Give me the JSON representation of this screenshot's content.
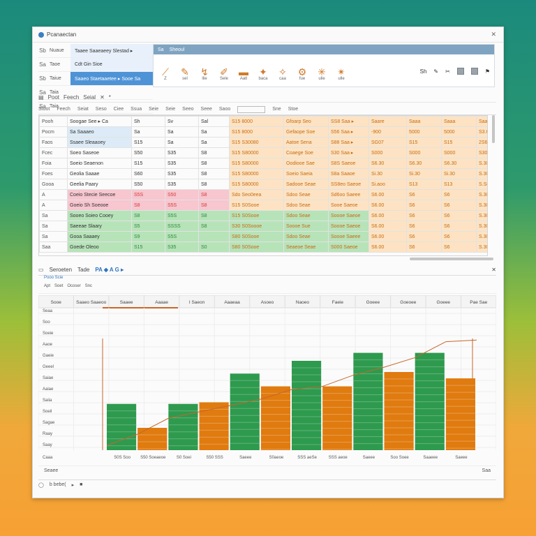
{
  "window": {
    "title": "Pcanaectan"
  },
  "nav": {
    "rows": [
      {
        "icon": "Sb",
        "label": "Nuaue",
        "value": "Taaee Saaeaeey   Slestad ▸"
      },
      {
        "icon": "Sa",
        "label": "Taoe",
        "value": "Cdt Gin  Sioe"
      },
      {
        "icon": "Sb",
        "label": "Taiue",
        "value": "Saaeo Staetaaetee ▸ Sooe Sa"
      },
      {
        "icon": "Sa",
        "label": "Taia",
        "value": ""
      },
      {
        "icon": "Sa",
        "label": "Taia",
        "value": ""
      }
    ]
  },
  "ribbon": {
    "tabs": [
      "Sa",
      "Sheoul"
    ],
    "tools": [
      "Z",
      "sel",
      "llie",
      "Sele",
      "Aatl",
      "baca",
      "caa",
      "fue",
      "ulie",
      "ulle"
    ],
    "right": [
      "Sh"
    ]
  },
  "toolbar2": {
    "items": [
      "Poot",
      "Feech",
      "Seial",
      "✕",
      "*"
    ]
  },
  "toolbar3": {
    "items": [
      "Stoot",
      "Feech",
      "Seiat",
      "Seso",
      "Ciee",
      "Ssua",
      "Seie",
      "Seie",
      "Seeo",
      "Seee",
      "Saoo",
      "Sne",
      "Stoe"
    ]
  },
  "sheet": {
    "rows": [
      {
        "a": "Pooh",
        "b": "Soogae See ▸ Ca",
        "c": "Sh",
        "d": "Sv",
        "e": "Sal",
        "f": "S15  8000",
        "g": "Gfoarp Seo",
        "h": "SS8 Saa ▸",
        "i": "Saare",
        "j": "Saaa",
        "k": "Saaa",
        "l": "Saaa",
        "style": "head"
      },
      {
        "a": "Pocm",
        "b": "Sa Saaaeo",
        "c": "Sa",
        "d": "Sa",
        "e": "Sa",
        "f": "S15  8000",
        "g": "Gefaope Soe",
        "h": "S56 Saa ▸",
        "i": "-900",
        "j": "5000",
        "k": "5000",
        "l": "S3.60",
        "style": "blue"
      },
      {
        "a": "Faos",
        "b": "Ssaee Sleaaoey",
        "c": "S15",
        "d": "Sa",
        "e": "Sa",
        "f": "S15  S30080",
        "g": "Aatoe Sena",
        "h": "S88 Saa ▸",
        "i": "SG07",
        "j": "S15",
        "k": "S15",
        "l": "2S63",
        "style": "blue"
      },
      {
        "a": "Fcec",
        "b": "Soeo Saseoe",
        "c": "S50",
        "d": "S35",
        "e": "S8",
        "f": "S15  S80000",
        "g": "Coaege Soe",
        "h": "S30 Saa ▸",
        "i": "S000",
        "j": "S000",
        "k": "S000",
        "l": "S30",
        "style": "white"
      },
      {
        "a": "Foia",
        "b": "Soeio Seaenon",
        "c": "S15",
        "d": "S35",
        "e": "S8",
        "f": "S15  S80000",
        "g": "Oodiooe Sae",
        "h": "S8S Saeoe",
        "i": "S6.30",
        "j": "S6.30",
        "k": "S6.30",
        "l": "S.30",
        "style": "white"
      },
      {
        "a": "Foes",
        "b": "Geolia Saaae",
        "c": "S60",
        "d": "S35",
        "e": "S8",
        "f": "S15  S80000",
        "g": "Soeio Saeia",
        "h": "S8a Saaoe",
        "i": "Si.30",
        "j": "Si.30",
        "k": "Si.30",
        "l": "S.30",
        "style": "white"
      },
      {
        "a": "Gooa",
        "b": "Geelia Paary",
        "c": "S50",
        "d": "S35",
        "e": "S8",
        "f": "S15  S80000",
        "g": "Sadooe Seae",
        "h": "SS8eo Saeoe",
        "i": "Si.aoo",
        "j": "S13",
        "k": "S13",
        "l": "S.S8",
        "style": "white"
      },
      {
        "a": "A",
        "b": "Coeio Stecie Seecoe",
        "c": "S5S",
        "d": "S50",
        "e": "S8",
        "f": "Sdo  Seo0eea",
        "g": "Sdoo Seae",
        "h": "Sd6oo Saeee",
        "i": "S6.00",
        "j": "S6",
        "k": "S6",
        "l": "S.30",
        "style": "pink"
      },
      {
        "a": "A",
        "b": "Goeio Sh Soeooe",
        "c": "S8",
        "d": "S5S",
        "e": "S8",
        "f": "S15  S0Sooe",
        "g": "Sdoo Seae",
        "h": "Sooe Saeoe",
        "i": "S6.00",
        "j": "S6",
        "k": "S6",
        "l": "S.30",
        "style": "pink"
      },
      {
        "a": "Sa",
        "b": "Sooeo Soieo Cooey",
        "c": "S8",
        "d": "S5S",
        "e": "S8",
        "f": "S15  S0Sooe",
        "g": "Sdoo Seae",
        "h": "Soooe Saeoe",
        "i": "S6.00",
        "j": "S6",
        "k": "S6",
        "l": "S.30",
        "style": "green"
      },
      {
        "a": "Sa",
        "b": "Saeeae Slaary",
        "c": "S5",
        "d": "SSSS",
        "e": "S8",
        "f": "S30  S0Soooe",
        "g": "Soooe Sue",
        "h": "Soooe Saeoe",
        "i": "S6.00",
        "j": "S6",
        "k": "S6",
        "l": "S.30",
        "style": "green"
      },
      {
        "a": "Sa",
        "b": "Gooa Saaaey",
        "c": "S9",
        "d": "S5S",
        "e": "",
        "f": "S80  S0Sooe",
        "g": "Sdoo Seae",
        "h": "Soooe Saeee",
        "i": "S6.00",
        "j": "S6",
        "k": "S6",
        "l": "S.30",
        "style": "green"
      },
      {
        "a": "Saa",
        "b": "Goede Oleoo",
        "c": "S15",
        "d": "S35",
        "e": "S0",
        "f": "S80  S0Sooe",
        "g": "Seaeoe Seae",
        "h": "S000 Saeoe",
        "i": "S6.00",
        "j": "S6",
        "k": "S6",
        "l": "S.30",
        "style": "green"
      }
    ]
  },
  "panel": {
    "title": "Seroeten",
    "tab": "Tade",
    "tools": "PA ◆ A G ▸",
    "sub": "Pooo  Scie",
    "filters": [
      "Apt",
      "Soet",
      "Ocoser",
      "Snc"
    ]
  },
  "chart_data": {
    "type": "bar",
    "categories": [
      "Sooe",
      "Saaeo Saaeoo",
      "Saaee",
      "Aaaae",
      "I Saeon",
      "Aaaeaa",
      "Asoeo",
      "Naoeo",
      "Faeie",
      "Goeee",
      "Goeoee",
      "Goeee",
      "Pae Sae"
    ],
    "ylabels": [
      "Seaa",
      "Soo",
      "Soeie",
      "Aaoe",
      "Gaeie",
      "Geeel",
      "Saiae",
      "Aaiae",
      "Saiia",
      "Soeil",
      "Sagae",
      "Raay",
      "Saay"
    ],
    "xlabels": [
      "S0S Soo",
      "S50 Soeaeoe",
      "S0 Soei",
      "S50 SSS",
      "Saeee",
      "S0aeoe",
      "SSS aeSe",
      "SSS aeoe",
      "Saeee",
      "Soo Soee",
      "Saaeee",
      "Saeee"
    ],
    "series": [
      {
        "values": [
          29,
          0,
          29,
          0,
          48,
          0,
          56,
          0,
          61,
          0,
          61,
          0
        ]
      },
      {
        "values": [
          0,
          14,
          0,
          30,
          0,
          40,
          0,
          40,
          0,
          49,
          0,
          45
        ]
      }
    ],
    "colors": {
      "green": "#2e9a4e",
      "orange": "#e07b10",
      "line": "#c8662a"
    },
    "line_values": [
      3,
      10,
      20,
      24,
      28,
      32,
      38,
      40,
      47,
      52,
      58,
      68,
      69
    ]
  },
  "footer": {
    "left": "Seaee",
    "right": "Saa"
  },
  "status": {
    "items": [
      "◯",
      "b bebe(",
      "▸",
      "■"
    ]
  }
}
